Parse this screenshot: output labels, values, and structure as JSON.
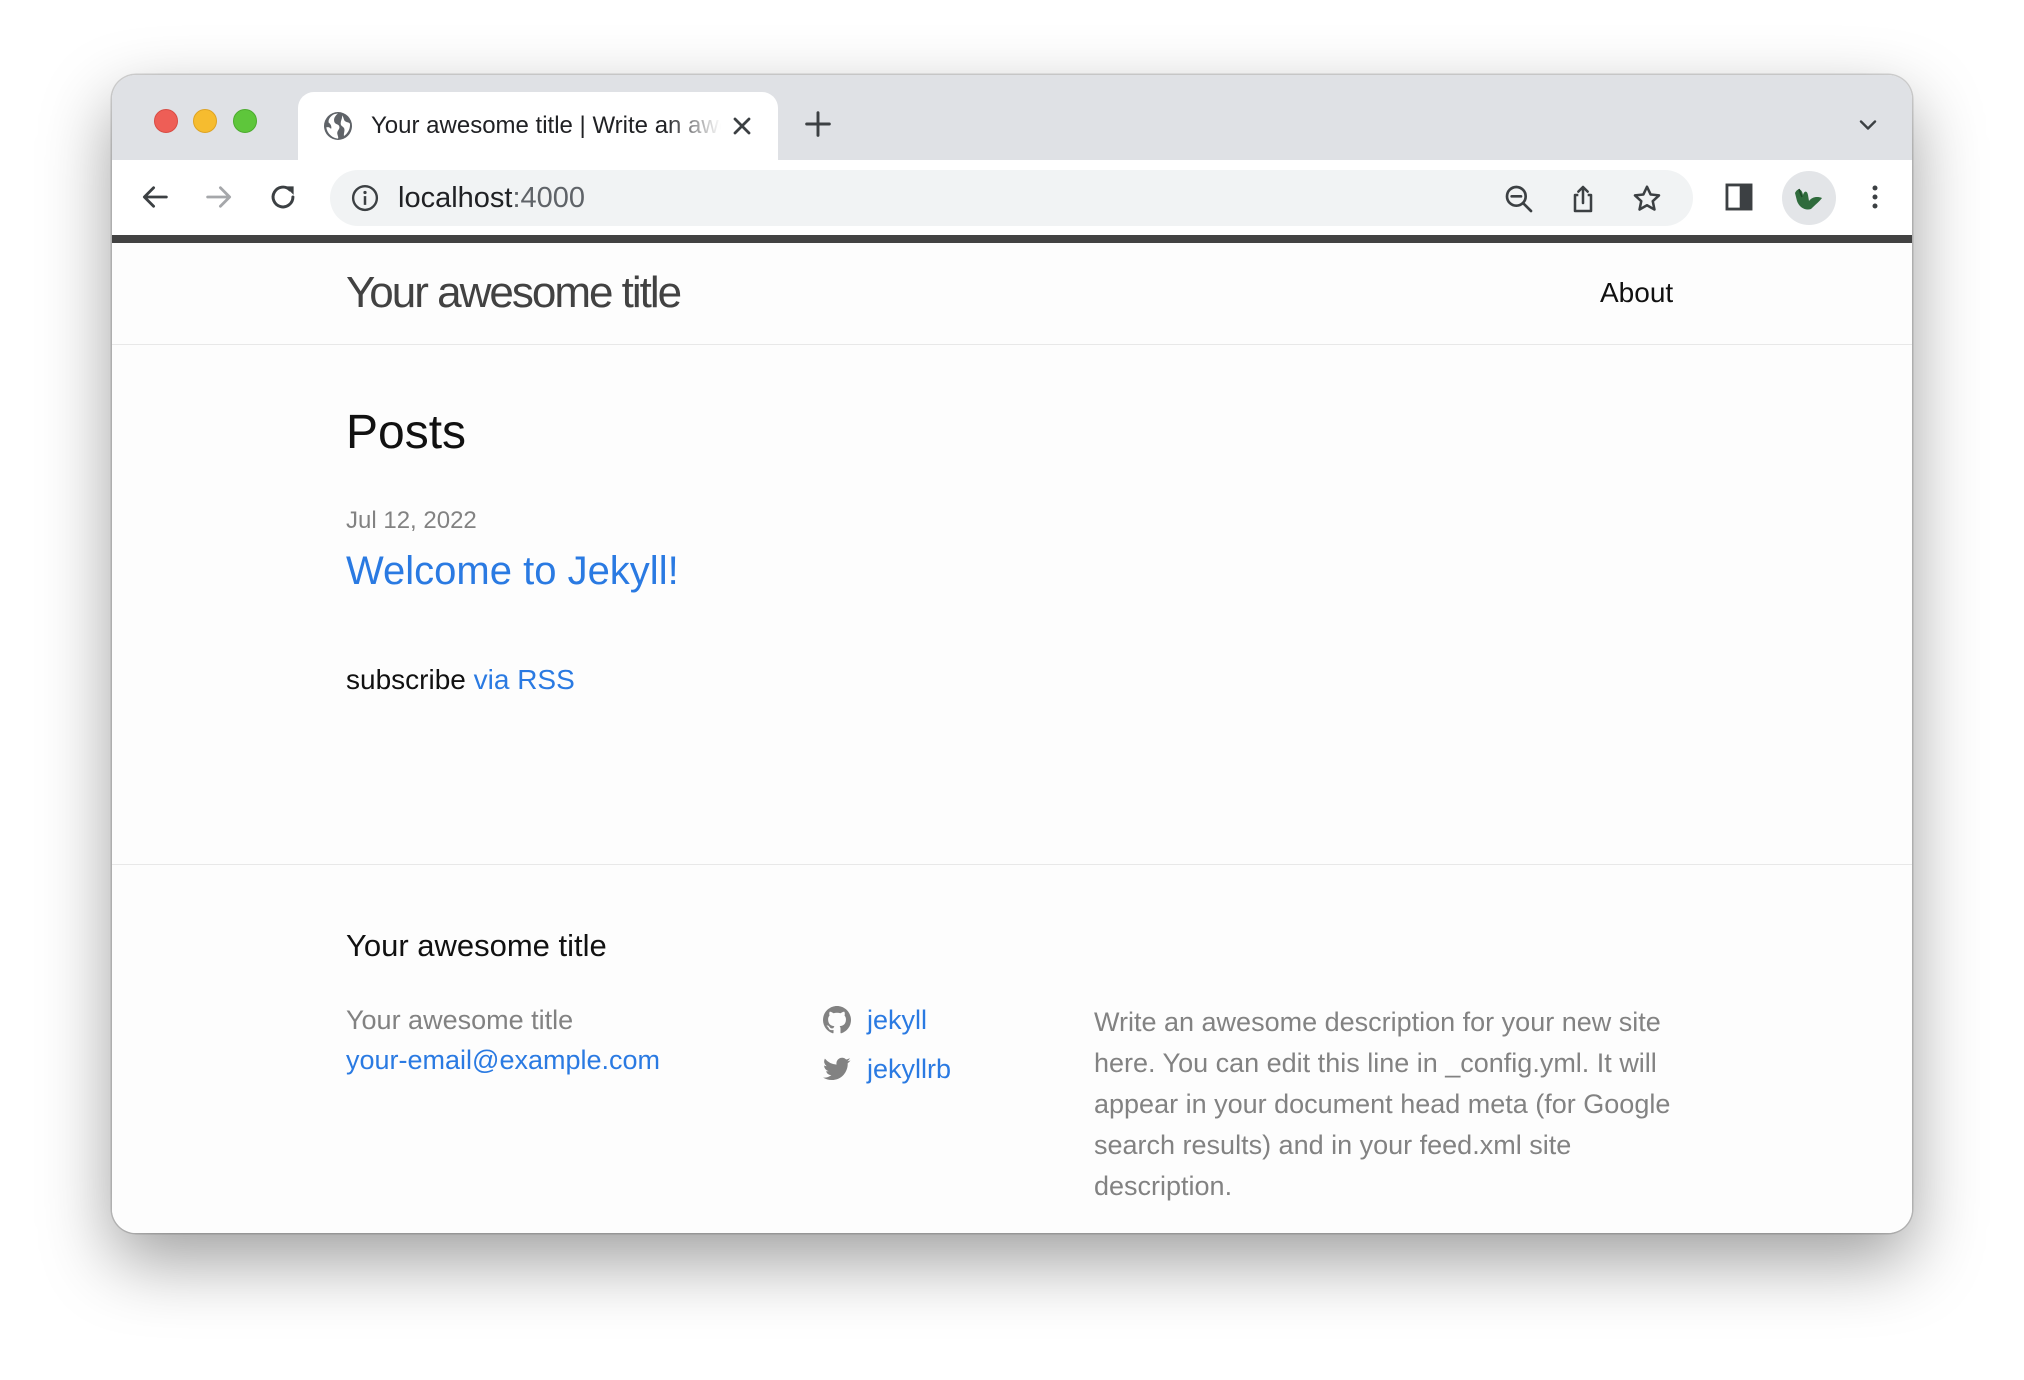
{
  "browser": {
    "tab": {
      "title": "Your awesome title | Write an awesome description for your new site here."
    },
    "address_bar": {
      "host": "localhost",
      "port": ":4000"
    }
  },
  "site": {
    "title": "Your awesome title",
    "nav": {
      "about": "About"
    }
  },
  "main": {
    "heading": "Posts",
    "posts": [
      {
        "date": "Jul 12, 2022",
        "title": "Welcome to Jekyll!"
      }
    ],
    "subscribe_text": "subscribe ",
    "subscribe_link": "via RSS"
  },
  "footer": {
    "heading": "Your awesome title",
    "name": "Your awesome title",
    "email": "your-email@example.com",
    "social": {
      "github": "jekyll",
      "twitter": "jekyllrb"
    },
    "description": "Write an awesome description for your new site here. You can edit this line in _config.yml. It will appear in your document head meta (for Google search results) and in your feed.xml site description."
  },
  "colors": {
    "link": "#2a7ae2",
    "text": "#111111",
    "muted": "#828282",
    "header_bar": "#424242"
  }
}
